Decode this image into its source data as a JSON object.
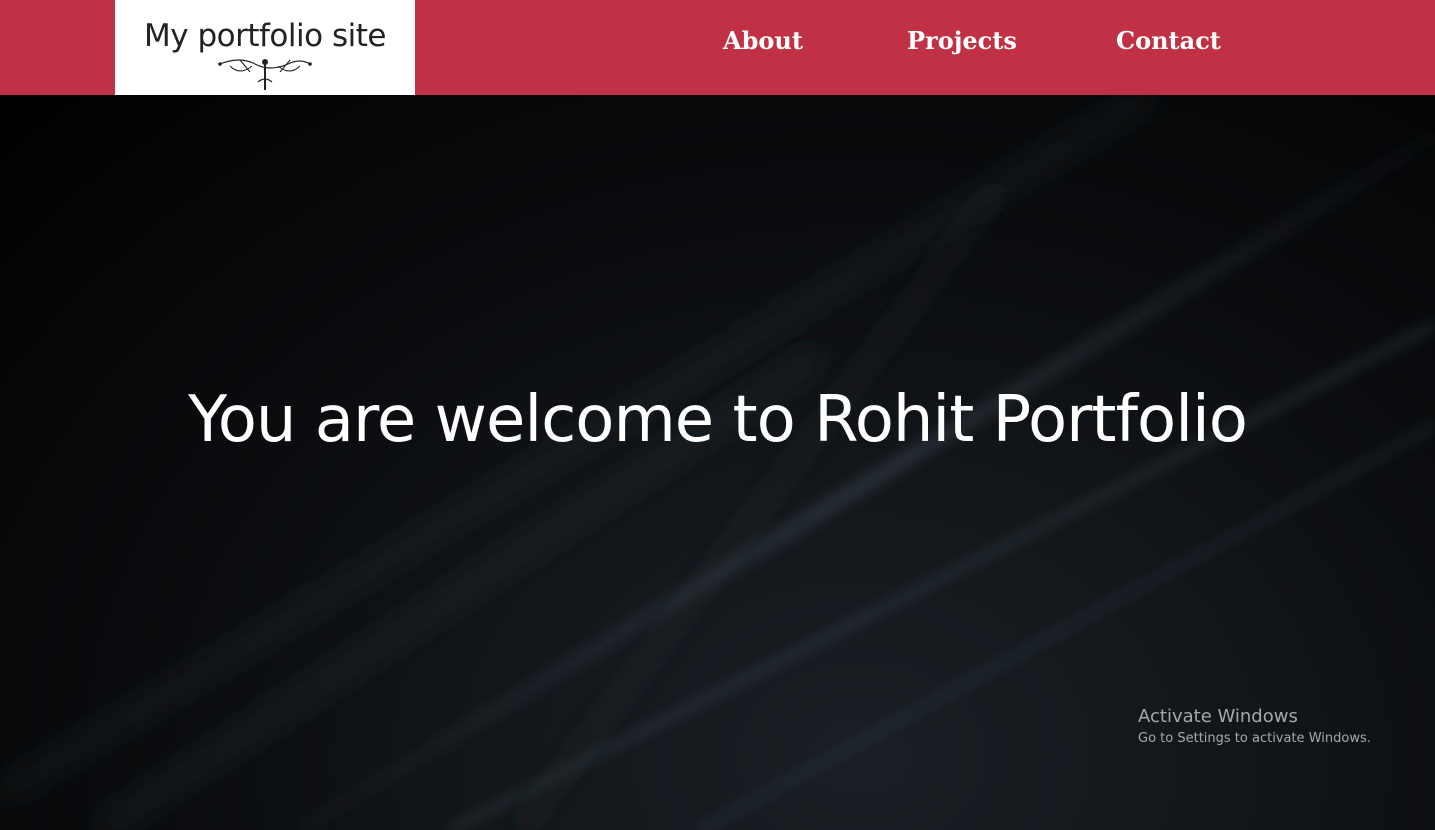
{
  "header": {
    "logo_text": "My portfolio site",
    "nav": [
      {
        "label": "About"
      },
      {
        "label": "Projects"
      },
      {
        "label": "Contact"
      }
    ]
  },
  "hero": {
    "title": "You are welcome to Rohit Portfolio"
  },
  "watermark": {
    "title": "Activate Windows",
    "subtitle": "Go to Settings to activate Windows."
  },
  "colors": {
    "header_bg": "#c03146",
    "logo_bg": "#ffffff",
    "hero_bg": "#000000",
    "text": "#ffffff"
  }
}
